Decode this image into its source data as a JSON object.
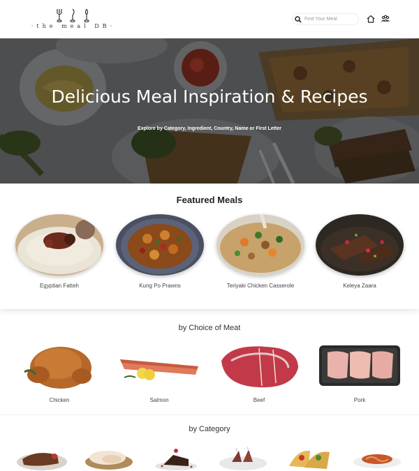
{
  "header": {
    "logo_text": "·the meal DB·",
    "search_placeholder": "Find Your Meal",
    "icons": [
      "search-icon",
      "home-icon",
      "people-icon"
    ]
  },
  "hero": {
    "title": "Delicious Meal Inspiration & Recipes",
    "subtitle": "Explore by Category, Ingredient, Country, Name or First Letter"
  },
  "featured": {
    "title": "Featured Meals",
    "meals": [
      {
        "name": "Egyptian Fatteh"
      },
      {
        "name": "Kung Po Prawns"
      },
      {
        "name": "Teriyaki Chicken Casserole"
      },
      {
        "name": "Keleya Zaara"
      }
    ]
  },
  "meat": {
    "title": "by Choice of Meat",
    "items": [
      {
        "name": "Chicken"
      },
      {
        "name": "Salmon"
      },
      {
        "name": "Beef"
      },
      {
        "name": "Pork"
      }
    ]
  },
  "category": {
    "title": "by Category"
  }
}
